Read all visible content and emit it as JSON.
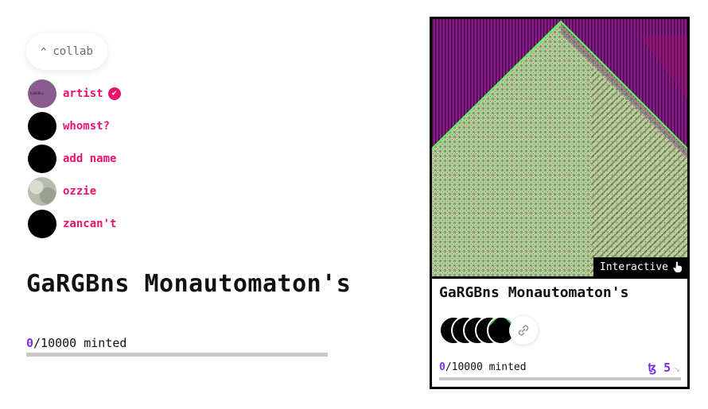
{
  "collab_toggle": {
    "chevron": "^",
    "label": "collab"
  },
  "authors": [
    {
      "name": "artist",
      "verified": true,
      "avatar": "artist-avatar"
    },
    {
      "name": "whomst?",
      "verified": false,
      "avatar": "black-avatar"
    },
    {
      "name": "add name",
      "verified": false,
      "avatar": "black-avatar"
    },
    {
      "name": "ozzie",
      "verified": false,
      "avatar": "photo-avatar"
    },
    {
      "name": "zancan't",
      "verified": false,
      "avatar": "black-avatar"
    }
  ],
  "verified_icon": "✔",
  "title": "GaRGBns Monautomaton's",
  "editions": {
    "minted": "0",
    "total": "/10000",
    "label": " minted",
    "progress": 0
  },
  "card": {
    "title": "GaRGBns Monautomaton's",
    "badge": "Interactive",
    "badge_icon": "hand-pointer-icon",
    "link_icon": "link-icon",
    "price_symbol": "ꜩ",
    "price": "5",
    "arrow": "↘"
  },
  "colors": {
    "accent": "#7b2cf0",
    "author": "#e8136e",
    "border": "#000000"
  }
}
